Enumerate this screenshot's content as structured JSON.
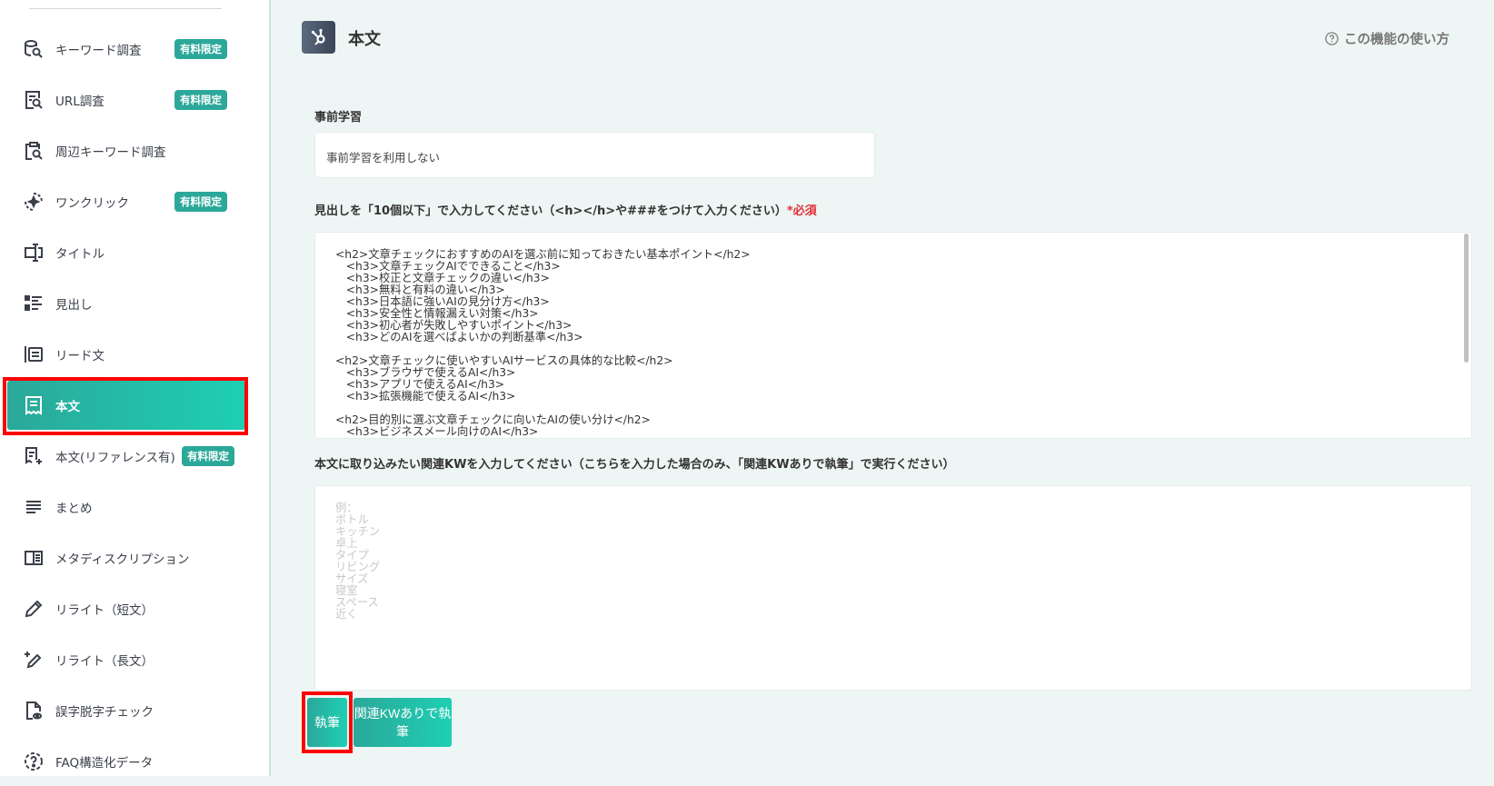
{
  "sidebar": {
    "items": [
      {
        "label": "キーワード調査",
        "badge": "有料限定",
        "icon": "keyword-search-icon"
      },
      {
        "label": "URL調査",
        "badge": "有料限定",
        "icon": "url-search-icon"
      },
      {
        "label": "周辺キーワード調査",
        "icon": "clipboard-search-icon"
      },
      {
        "label": "ワンクリック",
        "badge": "有料限定",
        "icon": "sparkle-icon"
      },
      {
        "label": "タイトル",
        "icon": "title-icon"
      },
      {
        "label": "見出し",
        "icon": "list-icon"
      },
      {
        "label": "リード文",
        "icon": "lead-icon"
      },
      {
        "label": "本文",
        "icon": "document-icon",
        "active": true
      },
      {
        "label": "本文(リファレンス有)",
        "badge": "有料限定",
        "icon": "document-plus-icon"
      },
      {
        "label": "まとめ",
        "icon": "lines-icon"
      },
      {
        "label": "メタディスクリプション",
        "icon": "book-icon"
      },
      {
        "label": "リライト（短文）",
        "icon": "pencil-icon"
      },
      {
        "label": "リライト（長文）",
        "icon": "pencil-plus-icon"
      },
      {
        "label": "誤字脱字チェック",
        "icon": "file-eye-icon"
      },
      {
        "label": "FAQ構造化データ",
        "icon": "question-icon"
      }
    ]
  },
  "header": {
    "title": "本文",
    "help": "この機能の使い方"
  },
  "form": {
    "pretrain_label": "事前学習",
    "pretrain_value": "事前学習を利用しない",
    "headings_label": "見出しを「10個以下」で入力してください（<h></h>や###をつけて入力ください）",
    "required": "*必須",
    "headings_value": "<h2>文章チェックにおすすめのAIを選ぶ前に知っておきたい基本ポイント</h2>\n   <h3>文章チェックAIでできること</h3>\n   <h3>校正と文章チェックの違い</h3>\n   <h3>無料と有料の違い</h3>\n   <h3>日本語に強いAIの見分け方</h3>\n   <h3>安全性と情報漏えい対策</h3>\n   <h3>初心者が失敗しやすいポイント</h3>\n   <h3>どのAIを選べばよいかの判断基準</h3>\n\n<h2>文章チェックに使いやすいAIサービスの具体的な比較</h2>\n   <h3>ブラウザで使えるAI</h3>\n   <h3>アプリで使えるAI</h3>\n   <h3>拡張機能で使えるAI</h3>\n\n<h2>目的別に選ぶ文章チェックに向いたAIの使い分け</h2>\n   <h3>ビジネスメール向けのAI</h3>",
    "kw_label": "本文に取り込みたい関連KWを入力してください（こちらを入力した場合のみ、「関連KWありで執筆」で実行ください）",
    "kw_placeholder": "例：\nボトル\nキッチン\n卓上\nタイプ\nリビング\nサイズ\n寝室\nスペース\n近く",
    "write_button": "執筆",
    "write_kw_button": "関連KWありで執筆"
  }
}
